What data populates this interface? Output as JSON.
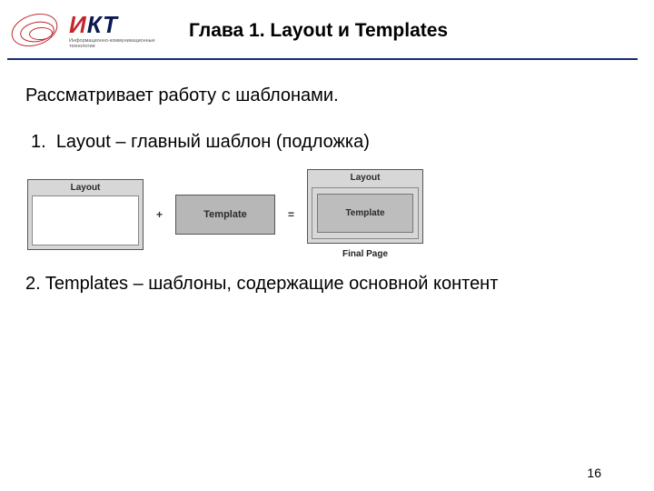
{
  "header": {
    "logo_text_main": "И",
    "logo_text_rest": "КТ",
    "logo_sub": "Информационно-коммуникационные технологии",
    "chapter_title": "Глава 1. Layout и Templates"
  },
  "content": {
    "intro": "Рассматривает работу с шаблонами.",
    "item1_num": "1.",
    "item1_text": "Layout – главный шаблон (подложка)",
    "item2_text": "2. Templates – шаблоны, содержащие основной контент"
  },
  "diagram": {
    "layout_label": "Layout",
    "plus": "+",
    "template_label": "Template",
    "equals": "=",
    "result_layout_label": "Layout",
    "result_template_label": "Template",
    "result_caption": "Final Page"
  },
  "page_number": "16"
}
